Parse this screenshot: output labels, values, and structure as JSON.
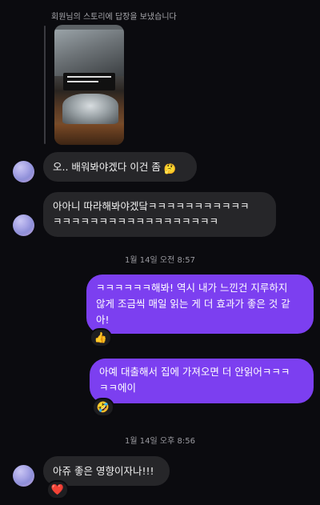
{
  "story_reply": {
    "caption": "회원님의 스토리에 답장을 보냈습니다"
  },
  "messages": [
    {
      "id": "m1",
      "side": "in",
      "text": "오.. 배워봐야겠다 이건 좀 ",
      "emoji": "🤔"
    },
    {
      "id": "m2",
      "side": "in",
      "line1": "아아니 따라해봐야겠닼ㅋㅋㅋㅋㅋㅋㅋㅋㅋㅋㅋ",
      "line2": "ㅋㅋㅋㅋㅋㅋㅋㅋㅋㅋㅋㅋㅋㅋㅋㅋㅋㅋ"
    },
    {
      "id": "m3",
      "side": "out",
      "line1": "ㅋㅋㅋㅋㅋㅋ해봐! 역시 내가 느낀건 지루하지",
      "line2": "않게 조금씩 매일 읽는 게 더 효과가 좋은 것 같",
      "line3": "아!",
      "reaction": "👍"
    },
    {
      "id": "m4",
      "side": "out",
      "line1": "아예 대출해서 집에 가져오면 더 안읽어ㅋㅋㅋ",
      "line2": "ㅋㅋ에이",
      "reaction": "🤣"
    },
    {
      "id": "m5",
      "side": "in",
      "text": "아쥬 좋은 영향이자나!!!",
      "reaction": "❤️"
    }
  ],
  "timestamps": {
    "t1": "1월 14일 오전 8:57",
    "t2": "1월 14일 오후 8:56"
  },
  "colors": {
    "background": "#0b0b0f",
    "incoming_bubble": "#262629",
    "outgoing_bubble": "#7c3ff0"
  }
}
